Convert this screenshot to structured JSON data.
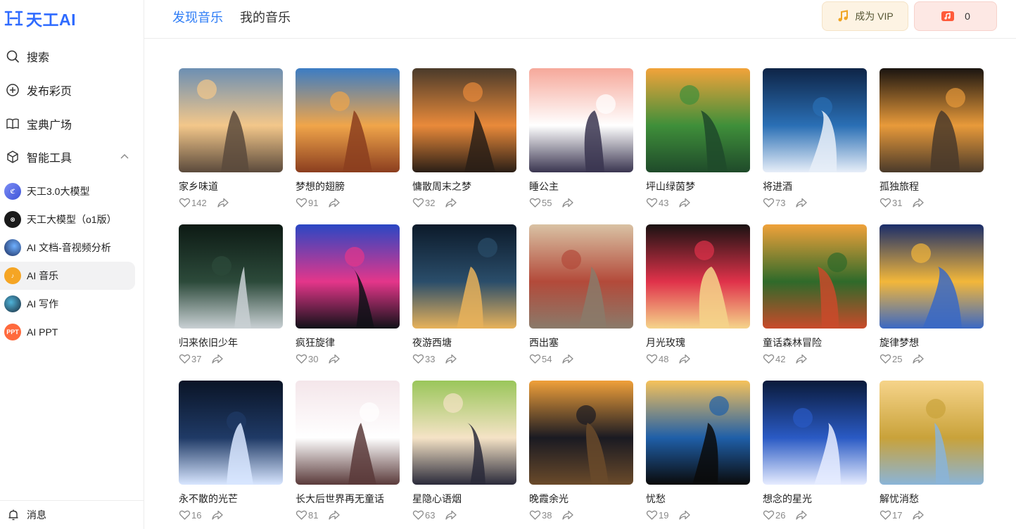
{
  "app": {
    "logo_text": "天工AI"
  },
  "sidebar": {
    "nav": [
      {
        "label": "搜索",
        "icon": "search-icon"
      },
      {
        "label": "发布彩页",
        "icon": "plus-circle-icon"
      },
      {
        "label": "宝典广场",
        "icon": "book-icon"
      },
      {
        "label": "智能工具",
        "icon": "cube-icon"
      }
    ],
    "tools": [
      {
        "label": "天工3.0大模型",
        "color": "#5b6ee8"
      },
      {
        "label": "天工大模型（o1版）",
        "color": "#1a1a1a"
      },
      {
        "label": "AI 文档-音视频分析",
        "color": "#2a3a6e"
      },
      {
        "label": "AI 音乐",
        "color": "#f5a524"
      },
      {
        "label": "AI 写作",
        "color": "#1d5c7a"
      },
      {
        "label": "AI PPT",
        "color": "#ff6a3d",
        "badge": "PPT"
      }
    ],
    "messages_label": "消息"
  },
  "header": {
    "tabs": [
      {
        "label": "发现音乐"
      },
      {
        "label": "我的音乐"
      }
    ],
    "vip_label": "成为 VIP",
    "coin_count": "0"
  },
  "songs": [
    {
      "title": "家乡味道",
      "likes": "142",
      "palette": [
        "#6c8fb3",
        "#f3c78a",
        "#5b4a3c"
      ]
    },
    {
      "title": "梦想的翅膀",
      "likes": "91",
      "palette": [
        "#3b7cc4",
        "#f0a54a",
        "#8b3e1f"
      ]
    },
    {
      "title": "慵散周末之梦",
      "likes": "32",
      "palette": [
        "#4a3a2a",
        "#e98a3a",
        "#2a1e16"
      ]
    },
    {
      "title": "睡公主",
      "likes": "55",
      "palette": [
        "#f6a89a",
        "#ffffff",
        "#3a3550"
      ]
    },
    {
      "title": "坪山绿茵梦",
      "likes": "43",
      "palette": [
        "#f2a33a",
        "#3f8f3a",
        "#1f4a2a"
      ]
    },
    {
      "title": "将进酒",
      "likes": "73",
      "palette": [
        "#0e2446",
        "#2a6fb5",
        "#e7eef8"
      ]
    },
    {
      "title": "孤独旅程",
      "likes": "31",
      "palette": [
        "#1a1410",
        "#e89a3a",
        "#4a3a2a"
      ]
    },
    {
      "title": "归来依旧少年",
      "likes": "37",
      "palette": [
        "#0d1a14",
        "#2c4a3a",
        "#c9d0d4"
      ]
    },
    {
      "title": "疯狂旋律",
      "likes": "30",
      "palette": [
        "#2a47c4",
        "#e4368a",
        "#111118"
      ]
    },
    {
      "title": "夜游西塘",
      "likes": "33",
      "palette": [
        "#0c1a2a",
        "#2a4d6a",
        "#e8b25a"
      ]
    },
    {
      "title": "西出塞",
      "likes": "54",
      "palette": [
        "#d9c2a4",
        "#b34a3a",
        "#8a7a6a"
      ]
    },
    {
      "title": "月光玫瑰",
      "likes": "48",
      "palette": [
        "#1a1212",
        "#e0324a",
        "#f5d48a"
      ]
    },
    {
      "title": "童话森林冒险",
      "likes": "42",
      "palette": [
        "#f0a23a",
        "#2f6a2a",
        "#c94a2a"
      ]
    },
    {
      "title": "旋律梦想",
      "likes": "25",
      "palette": [
        "#1a2d6a",
        "#f3b73a",
        "#3a68c4"
      ]
    },
    {
      "title": "永不散的光芒",
      "likes": "16",
      "palette": [
        "#0a1426",
        "#1f3a66",
        "#d8e6ff"
      ]
    },
    {
      "title": "长大后世界再无童话",
      "likes": "81",
      "palette": [
        "#f4e6ea",
        "#ffffff",
        "#5a3a3a"
      ]
    },
    {
      "title": "星隐心语烟",
      "likes": "63",
      "palette": [
        "#9ac65a",
        "#f5e3c6",
        "#2a2a3a"
      ]
    },
    {
      "title": "晚霞余光",
      "likes": "38",
      "palette": [
        "#f0a03a",
        "#1a1a22",
        "#6a4a2a"
      ]
    },
    {
      "title": "忧愁",
      "likes": "19",
      "palette": [
        "#f6c25a",
        "#1f5fa8",
        "#0a0a0a"
      ]
    },
    {
      "title": "想念的星光",
      "likes": "26",
      "palette": [
        "#0a1a3a",
        "#2a5ac4",
        "#e6ecff"
      ]
    },
    {
      "title": "解忧消愁",
      "likes": "17",
      "palette": [
        "#f6d48a",
        "#c9a23a",
        "#8ab4d8"
      ]
    }
  ]
}
